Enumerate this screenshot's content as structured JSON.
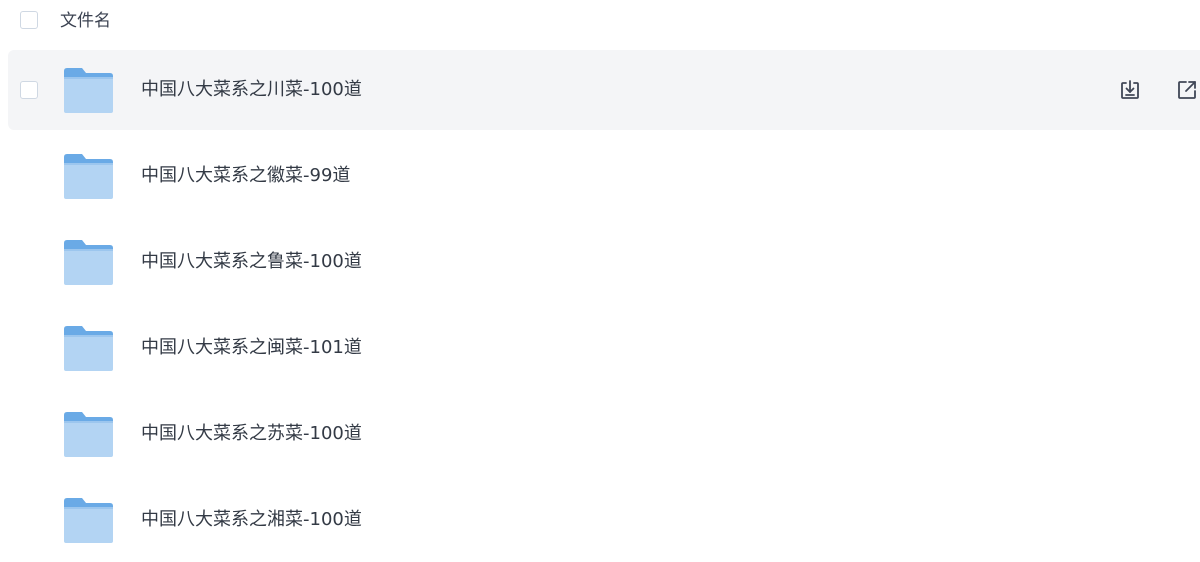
{
  "header": {
    "column_label": "文件名"
  },
  "files": [
    {
      "name": "中国八大菜系之川菜-100道",
      "type": "folder",
      "hovered": true
    },
    {
      "name": "中国八大菜系之徽菜-99道",
      "type": "folder",
      "hovered": false
    },
    {
      "name": "中国八大菜系之鲁菜-100道",
      "type": "folder",
      "hovered": false
    },
    {
      "name": "中国八大菜系之闽菜-101道",
      "type": "folder",
      "hovered": false
    },
    {
      "name": "中国八大菜系之苏菜-100道",
      "type": "folder",
      "hovered": false
    },
    {
      "name": "中国八大菜系之湘菜-100道",
      "type": "folder",
      "hovered": false
    }
  ],
  "row_actions": [
    {
      "icon": "download-icon"
    },
    {
      "icon": "share-icon"
    }
  ],
  "colors": {
    "hover_row_bg": "#f4f5f7",
    "folder_light": "#b3d4f3",
    "folder_dark": "#6aaae6",
    "text": "#333a45",
    "icon": "#3f4656"
  }
}
